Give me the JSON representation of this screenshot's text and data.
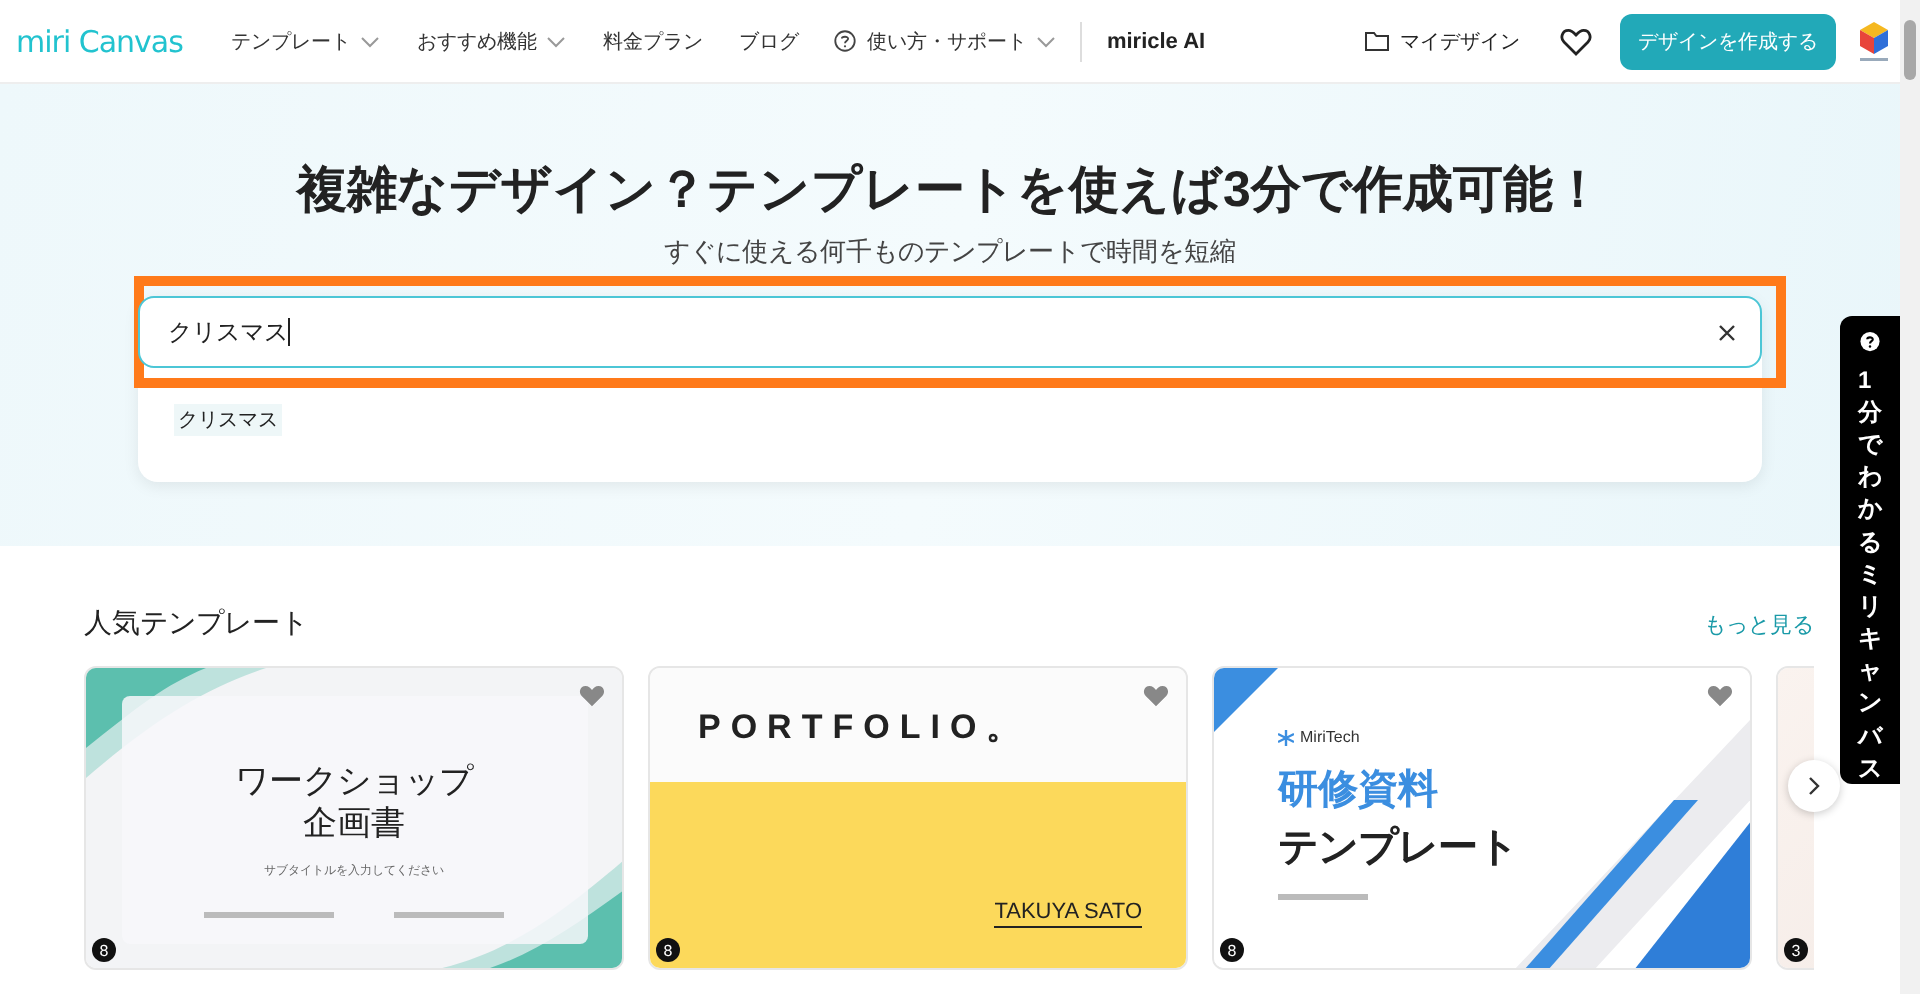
{
  "header": {
    "logo": "miri Canvas",
    "nav": [
      {
        "label": "テンプレート",
        "kind": "menu"
      },
      {
        "label": "おすすめ機能",
        "kind": "menu"
      },
      {
        "label": "料金プラン",
        "kind": "link"
      },
      {
        "label": "ブログ",
        "kind": "link"
      },
      {
        "label": "使い方・サポート",
        "kind": "help-menu"
      }
    ],
    "ai_link": "miricle AI",
    "my_designs": "マイデザイン",
    "create_button": "デザインを作成する"
  },
  "hero": {
    "title": "複雑なデザイン？テンプレートを使えば3分で作成可能！",
    "subtitle": "すぐに使える何千ものテンプレートで時間を短縮",
    "search": {
      "value": "クリスマス",
      "highlighted": true
    },
    "suggestions": [
      {
        "label": "クリスマス"
      }
    ]
  },
  "section": {
    "title": "人気テンプレート",
    "more_link": "もっと見る",
    "templates": [
      {
        "kind": "workshop",
        "texts": [
          "ワークショップ",
          "企画書",
          "サブタイトルを入力してください"
        ],
        "pages": "8"
      },
      {
        "kind": "portfolio",
        "texts": [
          "PORTFOLIO。",
          "TAKUYA SATO"
        ],
        "pages": "8"
      },
      {
        "kind": "training",
        "texts": [
          "MiriTech",
          "研修資料",
          "テンプレート"
        ],
        "pages": "8"
      },
      {
        "kind": "partial",
        "pages": "3"
      }
    ]
  },
  "side_tab": {
    "label": "1分でわかるミリキャンバス"
  }
}
